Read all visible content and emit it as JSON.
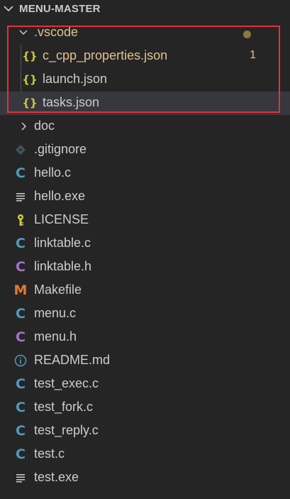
{
  "explorer": {
    "root_title": "MENU-MASTER",
    "vscode_folder": {
      "label": ".vscode",
      "files": [
        {
          "label": "c_cpp_properties.json",
          "badge": "1",
          "icon": "json-braces-icon"
        },
        {
          "label": "launch.json",
          "icon": "json-braces-icon"
        },
        {
          "label": "tasks.json",
          "icon": "json-braces-icon"
        }
      ]
    },
    "items": [
      {
        "label": "doc",
        "icon": "chevron-right-icon"
      },
      {
        "label": ".gitignore",
        "icon": "git-icon"
      },
      {
        "label": "hello.c",
        "icon": "c-file-icon"
      },
      {
        "label": "hello.exe",
        "icon": "text-lines-icon"
      },
      {
        "label": "LICENSE",
        "icon": "license-key-icon"
      },
      {
        "label": "linktable.c",
        "icon": "c-file-icon"
      },
      {
        "label": "linktable.h",
        "icon": "h-file-icon"
      },
      {
        "label": "Makefile",
        "icon": "makefile-icon"
      },
      {
        "label": "menu.c",
        "icon": "c-file-icon"
      },
      {
        "label": "menu.h",
        "icon": "h-file-icon"
      },
      {
        "label": "README.md",
        "icon": "info-icon"
      },
      {
        "label": "test_exec.c",
        "icon": "c-file-icon"
      },
      {
        "label": "test_fork.c",
        "icon": "c-file-icon"
      },
      {
        "label": "test_reply.c",
        "icon": "c-file-icon"
      },
      {
        "label": "test.c",
        "icon": "c-file-icon"
      },
      {
        "label": "test.exe",
        "icon": "text-lines-icon"
      }
    ]
  },
  "colors": {
    "background": "#252526",
    "selected_row": "#37373d",
    "highlight_box": "#e5303a",
    "modified_text": "#e2c08d",
    "json_icon": "#cbcb41",
    "c_icon": "#519aba",
    "h_icon": "#a074c4",
    "makefile_icon": "#e37933"
  }
}
